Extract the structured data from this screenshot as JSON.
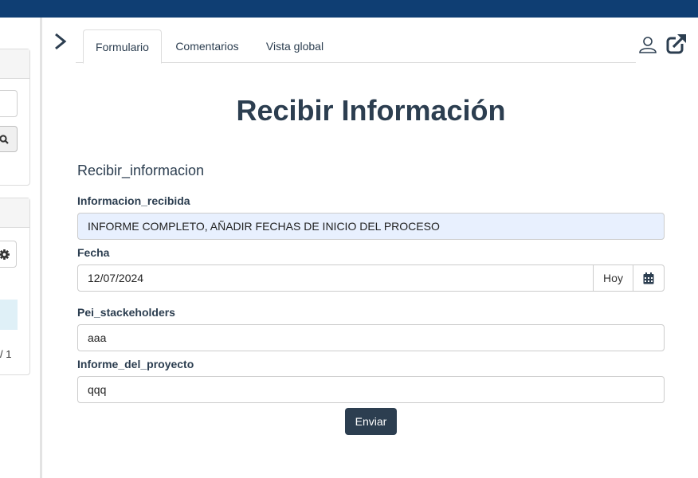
{
  "colors": {
    "topbar": "#0f3e73",
    "text": "#2c3e50",
    "button": "#2c3e50",
    "autofill": "#e8f0fe"
  },
  "left_panel": {
    "pagination": "/ 1"
  },
  "tabs": [
    {
      "label": "Formulario",
      "active": true
    },
    {
      "label": "Comentarios",
      "active": false
    },
    {
      "label": "Vista global",
      "active": false
    }
  ],
  "form": {
    "title": "Recibir Información",
    "subtitle": "Recibir_informacion",
    "fields": {
      "informacion": {
        "label": "Informacion_recibida",
        "value": "INFORME COMPLETO, AÑADIR FECHAS DE INICIO DEL PROCESO"
      },
      "fecha": {
        "label": "Fecha",
        "value": "12/07/2024",
        "today_label": "Hoy"
      },
      "pei": {
        "label": "Pei_stackeholders",
        "value": "aaa"
      },
      "informe": {
        "label": "Informe_del_proyecto",
        "value": "qqq"
      }
    },
    "submit_label": "Enviar"
  },
  "icons": [
    "chevron-right-icon",
    "user-icon",
    "external-link-icon",
    "search-icon",
    "gear-icon",
    "calendar-icon"
  ]
}
